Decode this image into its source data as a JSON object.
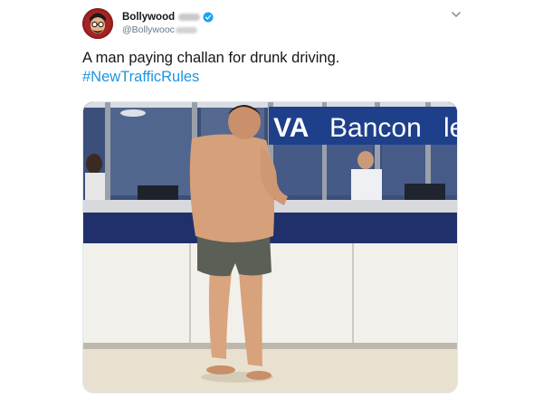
{
  "tweet": {
    "display_name": "Bollywood",
    "handle": "@Bollywooc",
    "text": "A man paying challan for drunk driving.",
    "hashtag": "#NewTrafficRules",
    "verified_color": "#1da1f2",
    "hashtag_color": "#1b95e0"
  },
  "photo": {
    "sign_left": "VA",
    "sign_right": "Bancon",
    "sign_tail": "le"
  },
  "icons": {
    "avatar": "avatar-cartoon-face",
    "verified": "verified-badge-icon",
    "menu": "chevron-down-icon"
  }
}
